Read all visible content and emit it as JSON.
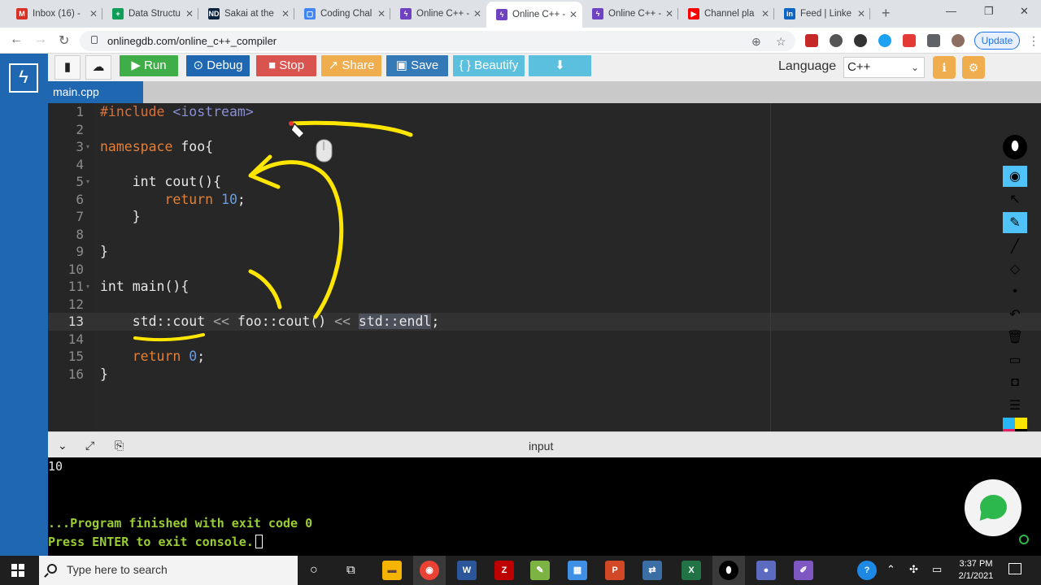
{
  "browser": {
    "tabs": [
      {
        "title": "Inbox (16) -",
        "icon": "gmail-icon",
        "color": "#d93025",
        "glyph": "M"
      },
      {
        "title": "Data Structu",
        "icon": "sheets-icon",
        "color": "#0f9d58",
        "glyph": "+"
      },
      {
        "title": "Sakai at the",
        "icon": "notre-dame-icon",
        "color": "#0c2340",
        "glyph": "ND"
      },
      {
        "title": "Coding Chal",
        "icon": "docs-icon",
        "color": "#4285f4",
        "glyph": "▢"
      },
      {
        "title": "Online C++ -",
        "icon": "onlinegdb-icon",
        "color": "#6f42c1",
        "glyph": "ϟ"
      },
      {
        "title": "Online C++ -",
        "icon": "onlinegdb-icon",
        "color": "#6f42c1",
        "glyph": "ϟ",
        "active": true
      },
      {
        "title": "Online C++ -",
        "icon": "onlinegdb-icon",
        "color": "#6f42c1",
        "glyph": "ϟ"
      },
      {
        "title": "Channel pla",
        "icon": "youtube-icon",
        "color": "#ff0000",
        "glyph": "▶"
      },
      {
        "title": "Feed | Linke",
        "icon": "linkedin-icon",
        "color": "#0a66c2",
        "glyph": "in"
      }
    ],
    "url": "onlinegdb.com/online_c++_compiler",
    "update_label": "Update"
  },
  "toolbar": {
    "run_label": "Run",
    "debug_label": "Debug",
    "stop_label": "Stop",
    "share_label": "Share",
    "save_label": "Save",
    "beautify_label": "{ } Beautify",
    "language_label": "Language",
    "language_value": "C++"
  },
  "colors": {
    "run": "#3fae49",
    "debug": "#1f67b1",
    "stop": "#d9534f",
    "share": "#f0ad4e",
    "save": "#337ab7",
    "beautify": "#5bc0de",
    "download": "#5bc0de",
    "annotation": "#ffe600"
  },
  "editor": {
    "file_tab": "main.cpp",
    "lines": [
      {
        "n": "1",
        "html": "<span class=\"pp\">#include</span> <span class=\"inc\">&lt;iostream&gt;</span>"
      },
      {
        "n": "2",
        "html": ""
      },
      {
        "n": "3",
        "html": "<span class=\"kw\">namespace</span> foo{",
        "fold": true
      },
      {
        "n": "4",
        "html": ""
      },
      {
        "n": "5",
        "html": "    int cout(){",
        "fold": true
      },
      {
        "n": "6",
        "html": "        <span class=\"kw\">return</span> <span class=\"num\">10</span>;"
      },
      {
        "n": "7",
        "html": "    }"
      },
      {
        "n": "8",
        "html": ""
      },
      {
        "n": "9",
        "html": "}"
      },
      {
        "n": "10",
        "html": ""
      },
      {
        "n": "11",
        "html": "int main(){",
        "fold": true
      },
      {
        "n": "12",
        "html": ""
      },
      {
        "n": "13",
        "html": "    std::cout <span class=\"op\">&lt;&lt;</span> foo::cout() <span class=\"op\">&lt;&lt;</span> <span class=\"sel\">std::endl</span>;",
        "current": true
      },
      {
        "n": "14",
        "html": ""
      },
      {
        "n": "15",
        "html": "    <span class=\"kw\">return</span> <span class=\"num\">0</span>;"
      },
      {
        "n": "16",
        "html": "}"
      }
    ]
  },
  "console": {
    "title": "input",
    "output": "10",
    "finished": "...Program finished with exit code 0",
    "prompt": "Press ENTER to exit console."
  },
  "taskbar": {
    "search_placeholder": "Type here to search",
    "time": "3:37 PM",
    "date": "2/1/2021"
  }
}
